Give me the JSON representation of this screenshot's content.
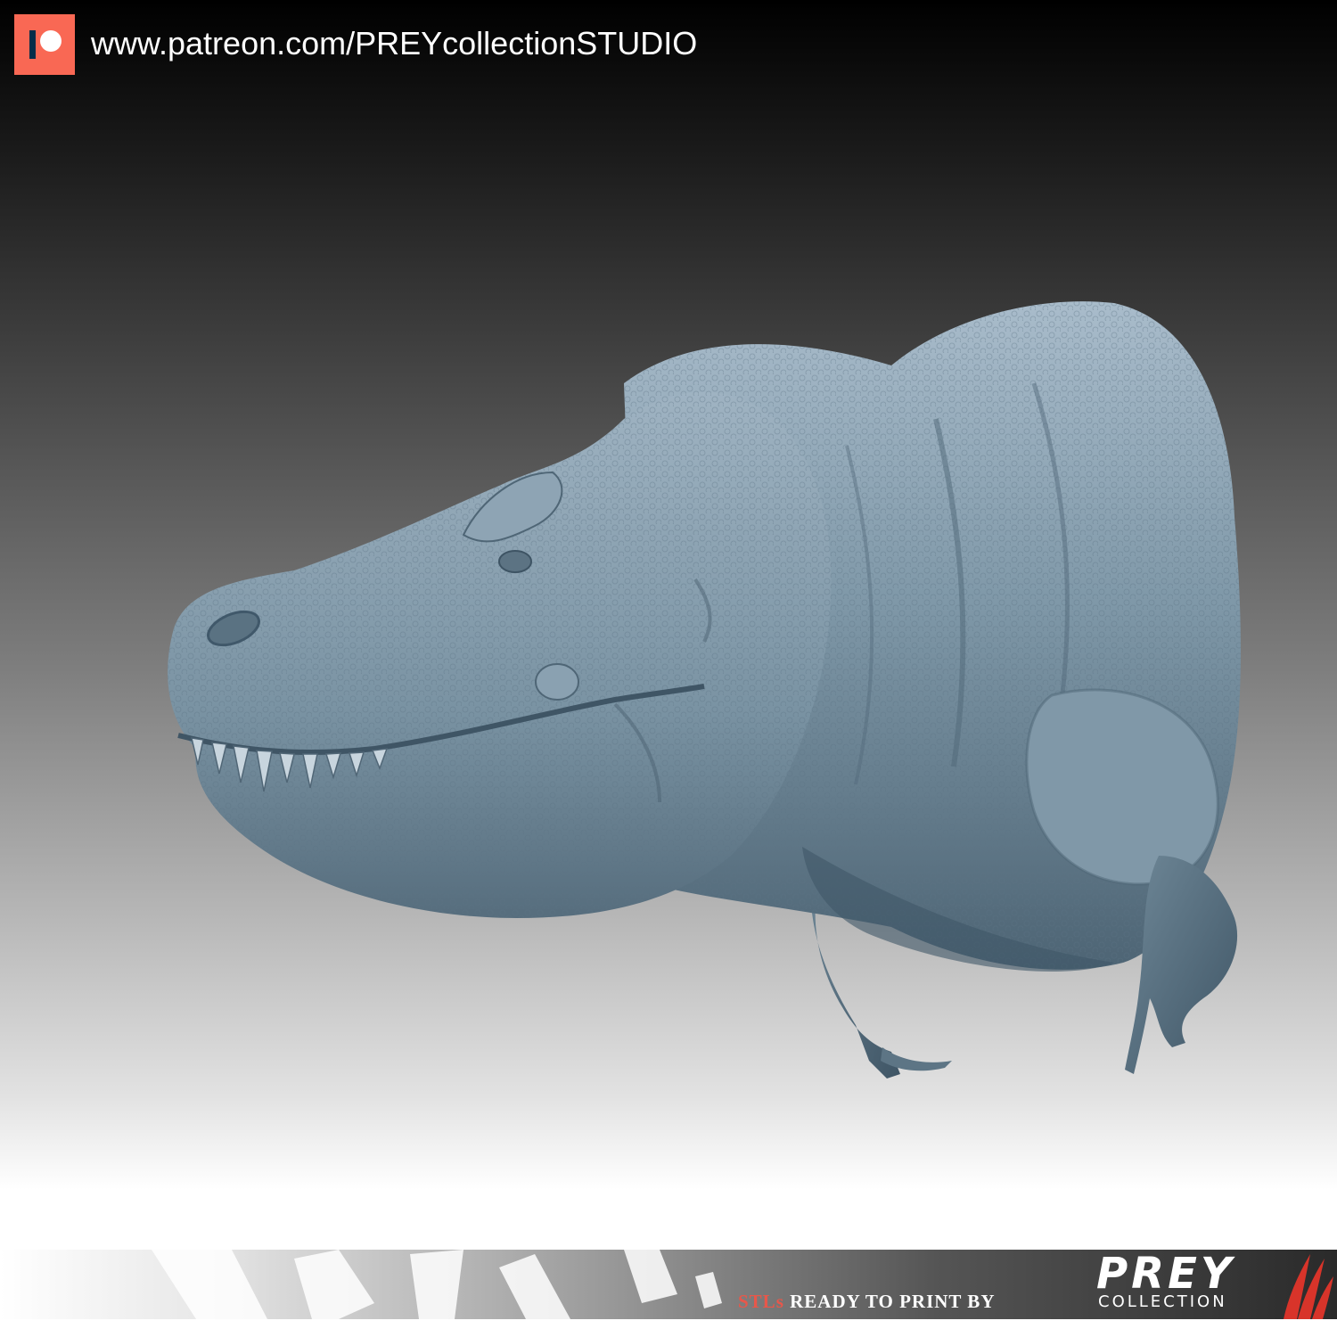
{
  "header": {
    "logo_icon": "patreon-icon",
    "url_text": "www.patreon.com/PREYcollectionSTUDIO",
    "logo_color": "#f96854"
  },
  "artwork": {
    "subject_icon": "dinosaur-sculpture",
    "model_color": "#7f98a8"
  },
  "footer": {
    "tagline_accent": "STLs",
    "tagline_rest": " READY TO PRINT BY",
    "accent_color": "#e8574a",
    "brand_logo": {
      "name": "PREY",
      "subtitle": "COLLECTION"
    }
  }
}
